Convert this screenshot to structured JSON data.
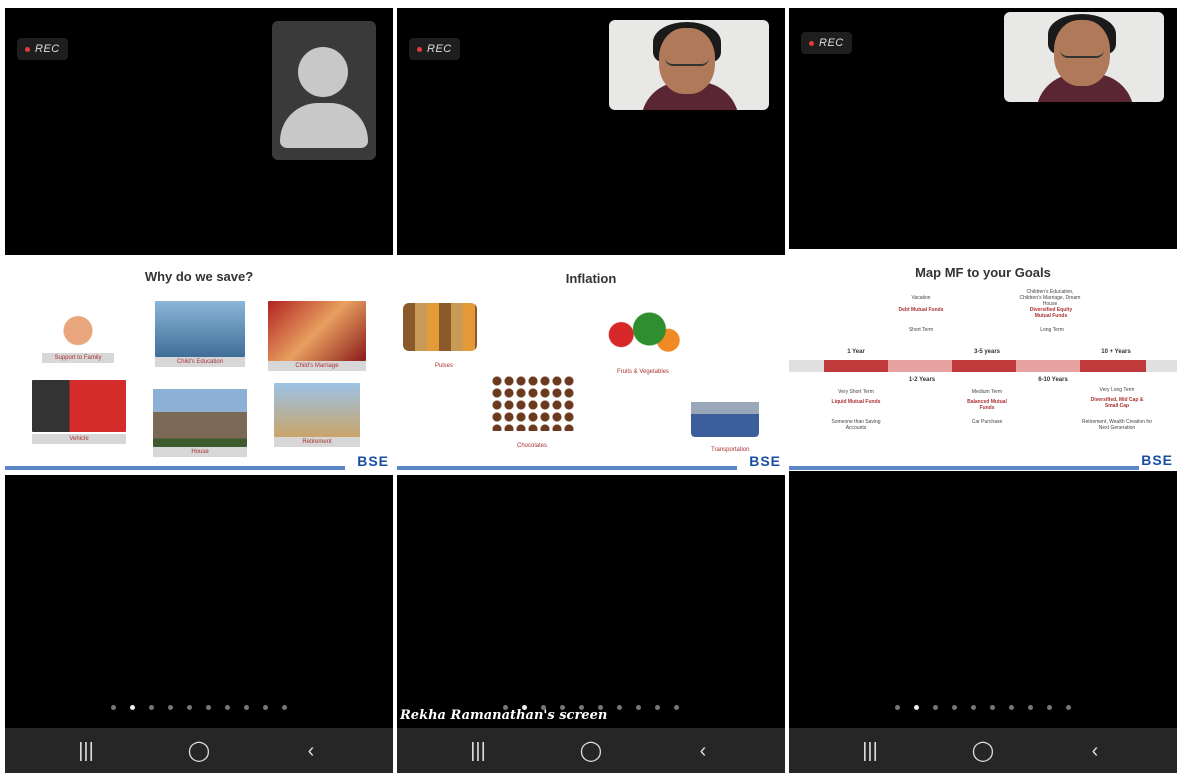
{
  "rec_label": "REC",
  "panels": [
    {
      "slide_title": "Why do we save?",
      "cards": [
        "Support to Family",
        "Child's Education",
        "Child's Marriage",
        "Vehicle",
        "House",
        "Retirement"
      ],
      "logo": "BSE",
      "page_dots": {
        "count": 10,
        "active": 1
      }
    },
    {
      "slide_title": "Inflation",
      "items": [
        "Pulses",
        "Fruits & Vegetables",
        "Chocolates",
        "Transportation"
      ],
      "logo": "BSE",
      "screen_caption": "Rekha Ramanathan's screen",
      "page_dots": {
        "count": 10,
        "active": 1
      }
    },
    {
      "slide_title": "Map MF to your Goals",
      "timeline": {
        "horizons": [
          "1 Year",
          "1-2 Years",
          "3-5 years",
          "6-10 Years",
          "10 + Years"
        ],
        "above": [
          {
            "goal": "Vacation",
            "fund": "Debt Mutual Funds",
            "term": "Short Term"
          },
          {
            "goal": "Children's Education, Children's Marriage, Dream House",
            "fund": "Diversified Equity Mutual Funds",
            "term": "Long Term"
          }
        ],
        "below": [
          {
            "term": "Very Short Term",
            "fund": "Liquid Mutual Funds",
            "goal": "Someone than Saving Accounts"
          },
          {
            "term": "Medium Term",
            "fund": "Balanced Mutual Funds",
            "goal": "Car Purchase"
          },
          {
            "term": "Very Long Term",
            "fund": "Diversified, Mid Cap & Small Cap",
            "goal": "Retirement, Wealth Creation for Next Generation"
          }
        ]
      },
      "logo": "BSE",
      "page_dots": {
        "count": 10,
        "active": 1
      }
    }
  ],
  "nav": {
    "recent_icon": "|||",
    "home_icon": "◯",
    "back_icon": "‹"
  },
  "colors": {
    "timeline_red": "#c0393b",
    "timeline_pink": "#e8a1a1",
    "footer_blue": "#5b87c7",
    "brand_blue": "#1a4fa0"
  }
}
